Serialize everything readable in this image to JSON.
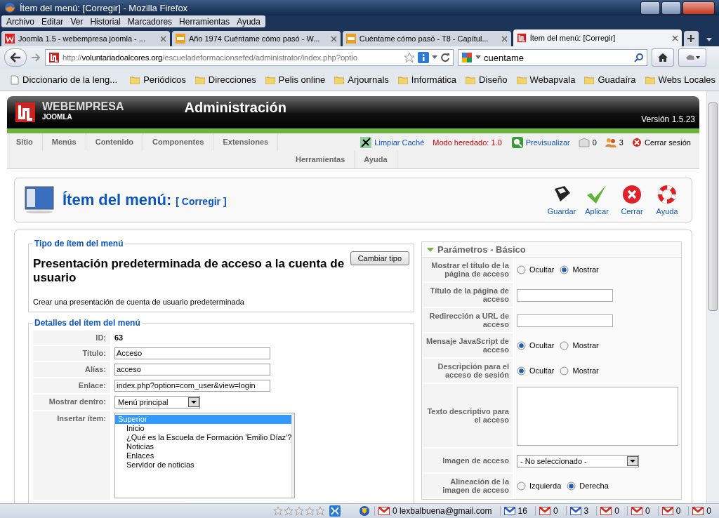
{
  "window": {
    "title": "Ítem del menú: [Corregir] - Mozilla Firefox"
  },
  "menu_bar": [
    "Archivo",
    "Editar",
    "Ver",
    "Historial",
    "Marcadores",
    "Herramientas",
    "Ayuda"
  ],
  "tabs": [
    {
      "label": "Joomla 1.5 - webempresa joomla - ...",
      "kind": "webempresa",
      "selected": false
    },
    {
      "label": "Año 1974 Cuéntame cómo pasó - W...",
      "kind": "rtve",
      "selected": false
    },
    {
      "label": "Cuéntame cómo pasó - T8 - Capítul...",
      "kind": "rtve",
      "selected": false
    },
    {
      "label": "Ítem del menú: [Corregir]",
      "kind": "joomla",
      "selected": true
    }
  ],
  "address_bar": {
    "scheme": "http://",
    "host": "voluntariadoalcores.org",
    "path": "/escueladeformacionsefed/administrator/index.php?optio"
  },
  "search_box": {
    "value": "cuentame"
  },
  "bookmarks": [
    {
      "label": "Diccionario de la leng...",
      "kind": "page"
    },
    {
      "label": "Periódicos",
      "kind": "folder"
    },
    {
      "label": "Direcciones",
      "kind": "folder"
    },
    {
      "label": "Pelis online",
      "kind": "folder"
    },
    {
      "label": "Arjournals",
      "kind": "folder"
    },
    {
      "label": "Informática",
      "kind": "folder"
    },
    {
      "label": "Diseño",
      "kind": "folder"
    },
    {
      "label": "Webapvala",
      "kind": "folder"
    },
    {
      "label": "Guadaíra",
      "kind": "folder"
    },
    {
      "label": "Webs Locales",
      "kind": "folder"
    }
  ],
  "joomla": {
    "brand": "WEBEMPRESA",
    "brand_sub": "JOOMLA",
    "title": "Administración",
    "version": "Versión 1.5.23",
    "menu": [
      "Sitio",
      "Menús",
      "Contenido",
      "Componentes",
      "Extensiones",
      "Herramientas",
      "Ayuda"
    ],
    "status": [
      {
        "label": "Limpiar Caché",
        "kind": "cache"
      },
      {
        "label": "Modo heredado: 1.0",
        "kind": "warning"
      },
      {
        "label": "Previsualizar",
        "kind": "preview"
      },
      {
        "label": "0",
        "kind": "messages"
      },
      {
        "label": "3",
        "kind": "users"
      },
      {
        "label": "Cerrar sesión",
        "kind": "logout"
      }
    ]
  },
  "toolbar": {
    "title": "Ítem del menú:",
    "subtitle": "[ Corregir ]",
    "buttons": [
      {
        "label": "Guardar",
        "kind": "save"
      },
      {
        "label": "Aplicar",
        "kind": "apply"
      },
      {
        "label": "Cerrar",
        "kind": "close"
      },
      {
        "label": "Ayuda",
        "kind": "help"
      }
    ]
  },
  "menu_item_type": {
    "legend": "Tipo de ítem del menú",
    "heading": "Presentación predeterminada de acceso a la cuenta de usuario",
    "description": "Crear una presentación de cuenta de usuario predeterminada",
    "button": "Cambiar tipo"
  },
  "details": {
    "legend": "Detalles del ítem del menú",
    "rows": [
      {
        "label": "ID:",
        "kind": "static",
        "value": "63"
      },
      {
        "label": "Título:",
        "kind": "text",
        "value": "Acceso"
      },
      {
        "label": "Alías:",
        "kind": "text",
        "value": "acceso"
      },
      {
        "label": "Enlace:",
        "kind": "text",
        "value": "index.php?option=com_user&view=login"
      },
      {
        "label": "Mostrar dentro:",
        "kind": "select",
        "value": "Menú principal"
      },
      {
        "label": "Insertar ítem:",
        "kind": "list",
        "options": [
          {
            "label": "Superior",
            "selected": true,
            "children": [
              {
                "label": "Inicio",
                "selected": false
              },
              {
                "label": "¿Qué es la Escuela de Formación 'Emilio Díaz'?",
                "selected": false
              },
              {
                "label": "Noticias",
                "selected": false
              },
              {
                "label": "Enlaces",
                "selected": false
              },
              {
                "label": "Servidor de noticias",
                "selected": false
              }
            ]
          }
        ]
      }
    ]
  },
  "parameters": {
    "title": "Parámetros - Básico",
    "expanded": true,
    "rows": [
      {
        "label": "Mostrar el título de la página de acceso",
        "kind": "radio",
        "options": [
          {
            "label": "Ocultar",
            "selected": false
          },
          {
            "label": "Mostrar",
            "selected": true
          }
        ]
      },
      {
        "label": "Título de la página de acceso",
        "kind": "text"
      },
      {
        "label": "Redirección a URL de acceso",
        "kind": "text"
      },
      {
        "label": "Mensaje JavaScript de acceso",
        "kind": "radio",
        "options": [
          {
            "label": "Ocultar",
            "selected": true
          },
          {
            "label": "Mostrar",
            "selected": false
          }
        ]
      },
      {
        "label": "Descripción para el acceso de sesión",
        "kind": "radio",
        "options": [
          {
            "label": "Ocultar",
            "selected": true
          },
          {
            "label": "Mostrar",
            "selected": false
          }
        ]
      },
      {
        "label": "Texto descriptivo para el acceso",
        "kind": "textarea"
      },
      {
        "label": "Imagen de acceso",
        "kind": "select",
        "value": "- No seleccionado -"
      },
      {
        "label": "Alineación de la imagen de acceso",
        "kind": "radio",
        "options": [
          {
            "label": "Izquierda",
            "selected": false
          },
          {
            "label": "Derecha",
            "selected": true
          }
        ]
      }
    ]
  },
  "status_bar": {
    "stars": 0,
    "mail": [
      {
        "count": "0 lexbalbuena@gmail.com",
        "color": "#d42a20"
      },
      {
        "count": "16",
        "color": "#3056c8"
      },
      {
        "count": "0",
        "color": "#d42a20"
      },
      {
        "count": "3",
        "color": "#3056c8"
      },
      {
        "count": "0",
        "color": "#d42a20"
      },
      {
        "count": "0",
        "color": "#d42a20"
      },
      {
        "count": "0",
        "color": "#d42a20"
      },
      {
        "count": "0",
        "color": "#d42a20"
      }
    ]
  }
}
